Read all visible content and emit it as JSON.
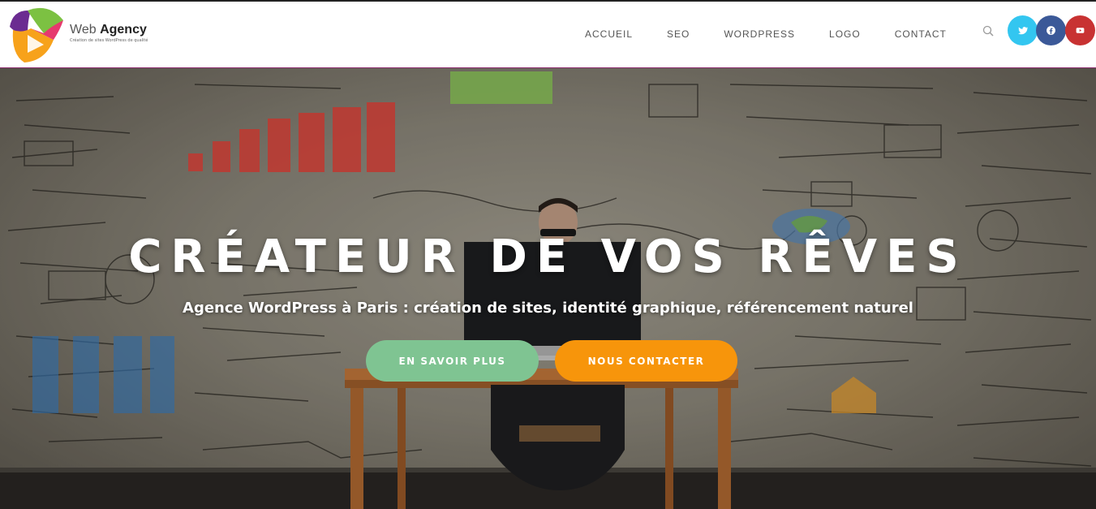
{
  "header": {
    "logo": {
      "name_light": "Web ",
      "name_bold": "Agency",
      "tagline": "Création de sites WordPress de qualité"
    },
    "nav": [
      {
        "label": "ACCUEIL"
      },
      {
        "label": "SEO"
      },
      {
        "label": "WORDPRESS"
      },
      {
        "label": "LOGO"
      },
      {
        "label": "CONTACT"
      }
    ],
    "search_icon": "search-icon",
    "social": [
      {
        "icon": "twitter-icon",
        "color": "#33c6f0"
      },
      {
        "icon": "facebook-icon",
        "color": "#3b5998"
      },
      {
        "icon": "youtube-icon",
        "color": "#c83232"
      }
    ]
  },
  "hero": {
    "title": "CRÉATEUR DE VOS RÊVES",
    "subtitle": "Agence WordPress à Paris : création de sites, identité graphique, référencement naturel",
    "buttons": {
      "more": {
        "label": "EN SAVOIR PLUS",
        "color": "#7fc492"
      },
      "contact": {
        "label": "NOUS CONTACTER",
        "color": "#f7950b"
      }
    }
  }
}
